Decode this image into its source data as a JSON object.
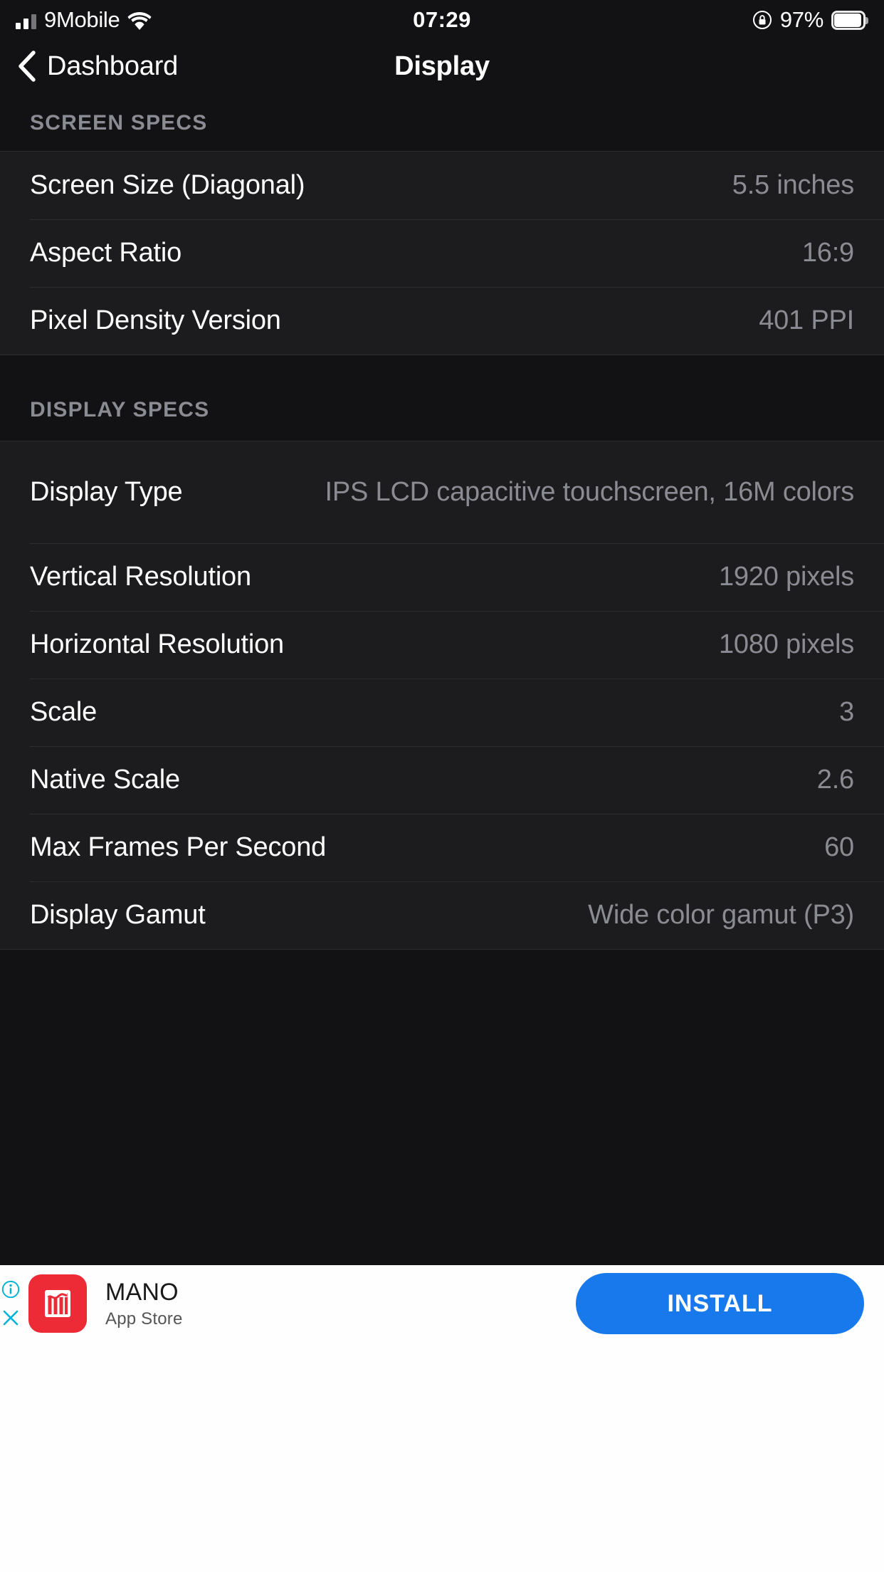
{
  "status_bar": {
    "carrier": "9Mobile",
    "time": "07:29",
    "battery_percent": "97%",
    "signal_icon": "cellular-signal-icon",
    "wifi_icon": "wifi-icon",
    "rotation_lock_icon": "rotation-lock-icon",
    "battery_icon": "battery-icon"
  },
  "nav": {
    "back_label": "Dashboard",
    "back_icon": "chevron-left-icon",
    "title": "Display"
  },
  "sections": [
    {
      "header": "SCREEN SPECS",
      "rows": [
        {
          "label": "Screen Size (Diagonal)",
          "value": "5.5 inches"
        },
        {
          "label": "Aspect Ratio",
          "value": "16:9"
        },
        {
          "label": "Pixel Density Version",
          "value": "401 PPI"
        }
      ]
    },
    {
      "header": "DISPLAY SPECS",
      "rows": [
        {
          "label": "Display Type",
          "value": "IPS LCD capacitive touchscreen, 16M colors"
        },
        {
          "label": "Vertical Resolution",
          "value": "1920 pixels"
        },
        {
          "label": "Horizontal Resolution",
          "value": "1080 pixels"
        },
        {
          "label": "Scale",
          "value": "3"
        },
        {
          "label": "Native Scale",
          "value": "2.6"
        },
        {
          "label": "Max Frames Per Second",
          "value": "60"
        },
        {
          "label": "Display Gamut",
          "value": "Wide color gamut (P3)"
        }
      ]
    }
  ],
  "ad": {
    "app_name": "MANO",
    "source": "App Store",
    "install_label": "INSTALL",
    "app_icon": "mano-app-icon",
    "info_icon": "ad-info-icon",
    "close_icon": "ad-close-icon"
  },
  "colors": {
    "page_background": "#121214",
    "group_background": "#1c1c1e",
    "separator": "#2d2d30",
    "primary_text": "#ffffff",
    "secondary_text": "#8b8b93",
    "accent_blue": "#1879ec",
    "app_icon_red": "#ec2b36",
    "ad_badge_cyan": "#00b2d6"
  }
}
